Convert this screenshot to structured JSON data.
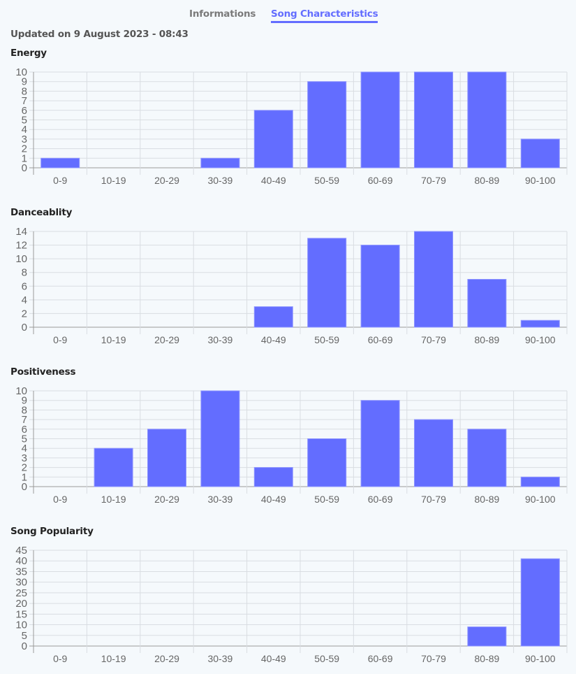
{
  "tabs": [
    {
      "label": "Informations",
      "active": false
    },
    {
      "label": "Song Characteristics",
      "active": true
    }
  ],
  "updated": "Updated on 9 August 2023 - 08:43",
  "colors": {
    "accent": "#636dff",
    "bar": "#636dff",
    "grid": "#d9dde2",
    "axis": "#9a9a9a",
    "tick_text": "#666666"
  },
  "chart_data": [
    {
      "type": "bar",
      "title": "Energy",
      "categories": [
        "0-9",
        "10-19",
        "20-29",
        "30-39",
        "40-49",
        "50-59",
        "60-69",
        "70-79",
        "80-89",
        "90-100"
      ],
      "values": [
        1,
        0,
        0,
        1,
        6,
        9,
        10,
        10,
        10,
        3
      ],
      "ylim": [
        0,
        10
      ],
      "yticks": [
        0,
        1,
        2,
        3,
        4,
        5,
        6,
        7,
        8,
        9,
        10
      ],
      "xlabel": "",
      "ylabel": "",
      "grid": true,
      "legend": "none"
    },
    {
      "type": "bar",
      "title": "Danceablity",
      "categories": [
        "0-9",
        "10-19",
        "20-29",
        "30-39",
        "40-49",
        "50-59",
        "60-69",
        "70-79",
        "80-89",
        "90-100"
      ],
      "values": [
        0,
        0,
        0,
        0,
        3,
        13,
        12,
        14,
        7,
        1
      ],
      "ylim": [
        0,
        14
      ],
      "yticks": [
        0,
        2,
        4,
        6,
        8,
        10,
        12,
        14
      ],
      "xlabel": "",
      "ylabel": "",
      "grid": true,
      "legend": "none"
    },
    {
      "type": "bar",
      "title": "Positiveness",
      "categories": [
        "0-9",
        "10-19",
        "20-29",
        "30-39",
        "40-49",
        "50-59",
        "60-69",
        "70-79",
        "80-89",
        "90-100"
      ],
      "values": [
        0,
        4,
        6,
        10,
        2,
        5,
        9,
        7,
        6,
        1
      ],
      "ylim": [
        0,
        10
      ],
      "yticks": [
        0,
        1,
        2,
        3,
        4,
        5,
        6,
        7,
        8,
        9,
        10
      ],
      "xlabel": "",
      "ylabel": "",
      "grid": true,
      "legend": "none"
    },
    {
      "type": "bar",
      "title": "Song Popularity",
      "categories": [
        "0-9",
        "10-19",
        "20-29",
        "30-39",
        "40-49",
        "50-59",
        "60-69",
        "70-79",
        "80-89",
        "90-100"
      ],
      "values": [
        0,
        0,
        0,
        0,
        0,
        0,
        0,
        0,
        9,
        41
      ],
      "ylim": [
        0,
        45
      ],
      "yticks": [
        0,
        5,
        10,
        15,
        20,
        25,
        30,
        35,
        40,
        45
      ],
      "xlabel": "",
      "ylabel": "",
      "grid": true,
      "legend": "none"
    }
  ]
}
